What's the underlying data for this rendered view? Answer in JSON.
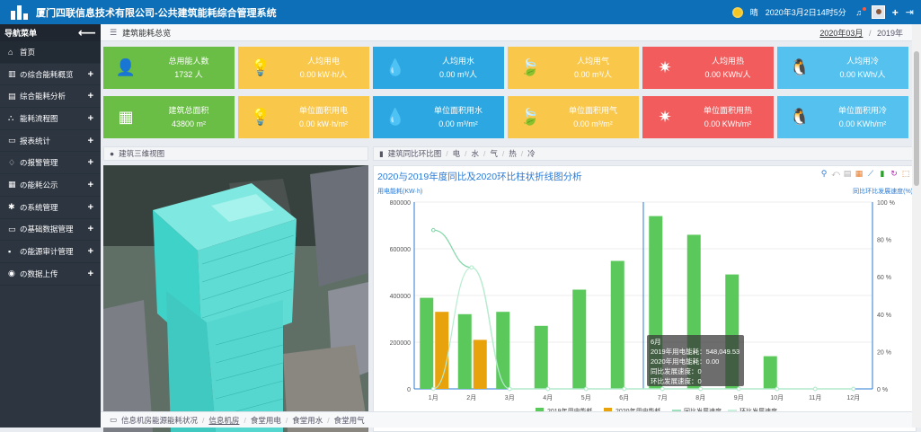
{
  "header": {
    "title": "厦门四联信息技术有限公司-公共建筑能耗综合管理系统",
    "weather": "晴",
    "datetime": "2020年3月2日14时5分"
  },
  "sidebar": {
    "title": "导航菜单",
    "items": [
      {
        "label": "首页",
        "icon": "home-icon"
      },
      {
        "label": "の综合能耗概览",
        "icon": "chart-icon"
      },
      {
        "label": "综合能耗分析",
        "icon": "analysis-icon"
      },
      {
        "label": "能耗流程图",
        "icon": "flow-icon"
      },
      {
        "label": "报表统计",
        "icon": "printer-icon"
      },
      {
        "label": "の报警管理",
        "icon": "bell-icon"
      },
      {
        "label": "の能耗公示",
        "icon": "grid-icon"
      },
      {
        "label": "の系统管理",
        "icon": "gear-icon"
      },
      {
        "label": "の基础数据管理",
        "icon": "card-icon"
      },
      {
        "label": "の能源审计管理",
        "icon": "briefcase-icon"
      },
      {
        "label": "の数据上传",
        "icon": "upload-icon"
      }
    ]
  },
  "breadcrumb": {
    "title": "建筑能耗总览",
    "month": "2020年03月",
    "sep": "/",
    "year": "2019年"
  },
  "cards": [
    {
      "label": "总用能人数",
      "value": "1732 人",
      "color": "#6abd45",
      "icon": "person-icon"
    },
    {
      "label": "人均用电",
      "value": "0.00 kW·h/人",
      "color": "#f9c74a",
      "icon": "bulb-icon"
    },
    {
      "label": "人均用水",
      "value": "0.00 m³/人",
      "color": "#2ca7e1",
      "icon": "drop-icon"
    },
    {
      "label": "人均用气",
      "value": "0.00 m³/人",
      "color": "#f9c74a",
      "icon": "leaf-icon"
    },
    {
      "label": "人均用热",
      "value": "0.00 KWh/人",
      "color": "#f25c5c",
      "icon": "sun-icon"
    },
    {
      "label": "人均用冷",
      "value": "0.00 KWh/人",
      "color": "#54c1ef",
      "icon": "penguin-icon"
    },
    {
      "label": "建筑总面积",
      "value": "43800 m²",
      "color": "#6abd45",
      "icon": "building-icon"
    },
    {
      "label": "单位面积用电",
      "value": "0.00 kW·h/m²",
      "color": "#f9c74a",
      "icon": "bulb-icon"
    },
    {
      "label": "单位面积用水",
      "value": "0.00 m³/m²",
      "color": "#2ca7e1",
      "icon": "drop-icon"
    },
    {
      "label": "单位面积用气",
      "value": "0.00 m³/m²",
      "color": "#f9c74a",
      "icon": "leaf-icon"
    },
    {
      "label": "单位面积用热",
      "value": "0.00 KWh/m²",
      "color": "#f25c5c",
      "icon": "sun-icon"
    },
    {
      "label": "单位面积用冷",
      "value": "0.00 KWh/m²",
      "color": "#54c1ef",
      "icon": "penguin-icon"
    }
  ],
  "view3d": {
    "title": "建筑三维视图"
  },
  "chart_panel": {
    "title": "建筑同比环比图",
    "tabs": [
      "电",
      "水",
      "气",
      "热",
      "冷"
    ]
  },
  "chart_data": {
    "type": "bar",
    "title": "2020与2019年度同比及2020环比柱状折线图分析",
    "ylabel": "用电能耗(KW·h)",
    "y2label": "同比环比发展速度(%)",
    "categories": [
      "1月",
      "2月",
      "3月",
      "4月",
      "5月",
      "6月",
      "7月",
      "8月",
      "9月",
      "10月",
      "11月",
      "12月"
    ],
    "ylim": [
      0,
      800000
    ],
    "yticks": [
      0,
      200000,
      400000,
      600000,
      800000
    ],
    "y2lim": [
      0,
      100
    ],
    "y2ticks": [
      "0 %",
      "20 %",
      "40 %",
      "60 %",
      "80 %",
      "100 %"
    ],
    "series": [
      {
        "name": "2019年用电能耗",
        "kind": "bar",
        "color": "#5ac85a",
        "values": [
          390000,
          320000,
          330000,
          270000,
          425000,
          548049.53,
          740000,
          660000,
          490000,
          140000,
          0,
          0
        ]
      },
      {
        "name": "2020年用电能耗",
        "kind": "bar",
        "color": "#e8a20c",
        "values": [
          330000,
          210000,
          0,
          0,
          0,
          0,
          0,
          0,
          0,
          0,
          0,
          0
        ]
      },
      {
        "name": "同比发展速度",
        "kind": "line",
        "color": "#7fd6a6",
        "values": [
          85,
          65,
          0,
          0,
          0,
          0,
          0,
          0,
          0,
          0,
          0,
          0
        ]
      },
      {
        "name": "环比发展速度",
        "kind": "line",
        "color": "#b8ecd0",
        "values": [
          0,
          65,
          0,
          0,
          0,
          0,
          0,
          0,
          0,
          0,
          0,
          0
        ]
      }
    ],
    "grid": true,
    "legend": "bottom"
  },
  "tooltip": {
    "month": "6月",
    "line1": "2019年用电能耗：548,049.53",
    "line2": "2020年用电能耗：0.00",
    "line3": "同比发展速度：0",
    "line4": "环比发展速度：0"
  },
  "bottombar": {
    "title": "信息机房能源能耗状况",
    "items": [
      "信息机房",
      "食堂用电",
      "食堂用水",
      "食堂用气"
    ]
  }
}
